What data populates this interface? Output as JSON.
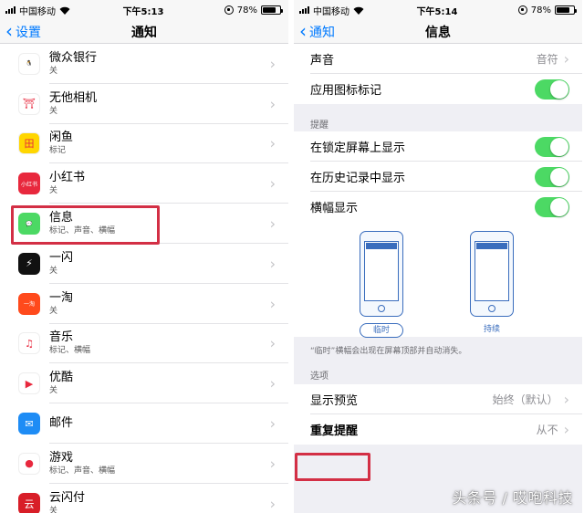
{
  "left": {
    "status": {
      "carrier": "中国移动",
      "time": "下午5:13",
      "battery": "78%"
    },
    "nav": {
      "back": "设置",
      "title": "通知"
    },
    "apps": [
      {
        "name": "微众银行",
        "sub": "关",
        "icon": "webank-icon",
        "color": "#ffffff",
        "glyph": "🐧"
      },
      {
        "name": "无他相机",
        "sub": "关",
        "icon": "wuta-camera-icon",
        "color": "#ffffff",
        "glyph": "⛩"
      },
      {
        "name": "闲鱼",
        "sub": "标记",
        "icon": "xianyu-icon",
        "color": "#ffd600",
        "glyph": "田"
      },
      {
        "name": "小红书",
        "sub": "关",
        "icon": "xiaohongshu-icon",
        "color": "#e8283d",
        "glyph": "小红书"
      },
      {
        "name": "信息",
        "sub": "标记、声音、横幅",
        "icon": "messages-icon",
        "color": "#4cd964",
        "glyph": "💬"
      },
      {
        "name": "一闪",
        "sub": "关",
        "icon": "yishan-icon",
        "color": "#111111",
        "glyph": "⚡"
      },
      {
        "name": "一淘",
        "sub": "关",
        "icon": "yitao-icon",
        "color": "#ff4a1c",
        "glyph": "一淘"
      },
      {
        "name": "音乐",
        "sub": "标记、横幅",
        "icon": "music-icon",
        "color": "#ffffff",
        "glyph": "♫"
      },
      {
        "name": "优酷",
        "sub": "关",
        "icon": "youku-icon",
        "color": "#ffffff",
        "glyph": "▶"
      },
      {
        "name": "邮件",
        "sub": "",
        "icon": "mail-icon",
        "color": "#1e8cf5",
        "glyph": "✉"
      },
      {
        "name": "游戏",
        "sub": "标记、声音、横幅",
        "icon": "game-center-icon",
        "color": "#ffffff",
        "glyph": "●"
      },
      {
        "name": "云闪付",
        "sub": "关",
        "icon": "unionpay-icon",
        "color": "#d81e28",
        "glyph": "云"
      }
    ]
  },
  "right": {
    "status": {
      "carrier": "中国移动",
      "time": "下午5:14",
      "battery": "78%"
    },
    "nav": {
      "back": "通知",
      "title": "信息"
    },
    "sound": {
      "label": "声音",
      "value": "音符"
    },
    "badge": {
      "label": "应用图标标记",
      "on": true
    },
    "alerts_header": "提醒",
    "lock_screen": {
      "label": "在锁定屏幕上显示",
      "on": true
    },
    "history": {
      "label": "在历史记录中显示",
      "on": true
    },
    "banners": {
      "label": "横幅显示",
      "on": true
    },
    "banner_styles": {
      "temporary": "临时",
      "persistent": "持续"
    },
    "banner_note": "“临时”横幅会出现在屏幕顶部并自动消失。",
    "options_header": "选项",
    "preview": {
      "label": "显示预览",
      "value": "始终（默认）"
    },
    "repeat": {
      "label": "重复提醒",
      "value": "从不"
    }
  },
  "watermark": "头条号 / 哎咆科技",
  "colors": {
    "accent": "#007aff",
    "toggle_on": "#4cd964",
    "highlight": "#d32f45"
  }
}
